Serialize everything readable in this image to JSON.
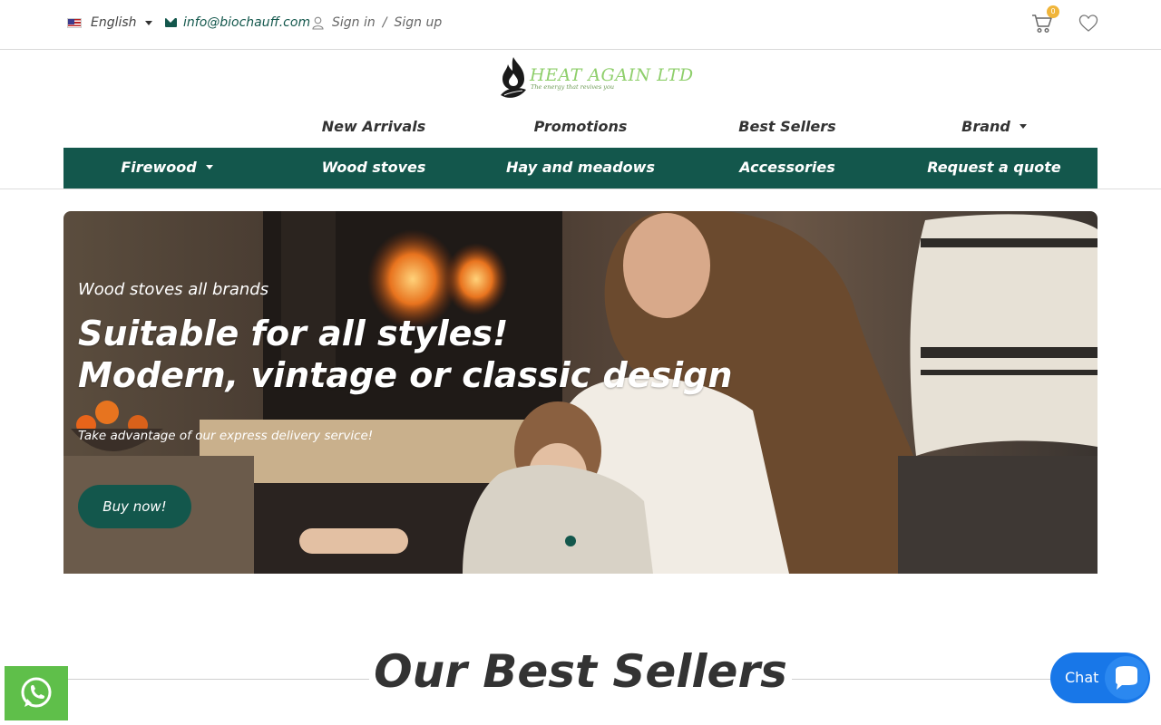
{
  "topbar": {
    "language": "English",
    "email": "info@biochauff.com",
    "sign_in": "Sign in",
    "separator": "/",
    "sign_up": "Sign up",
    "cart_count": "0",
    "icons": [
      "us-flag-icon",
      "envelope-icon",
      "user-icon",
      "cart-icon",
      "heart-icon"
    ]
  },
  "logo": {
    "name": "HEAT AGAIN LTD",
    "tagline": "The energy that revives you"
  },
  "nav_primary": [
    {
      "label": "New Arrivals"
    },
    {
      "label": "Promotions"
    },
    {
      "label": "Best Sellers"
    },
    {
      "label": "Brand"
    }
  ],
  "nav_secondary": [
    {
      "label": "Firewood"
    },
    {
      "label": "Wood stoves"
    },
    {
      "label": "Hay and meadows"
    },
    {
      "label": "Accessories"
    },
    {
      "label": "Request a quote"
    }
  ],
  "hero": {
    "kicker": "Wood stoves all brands",
    "headline_1": "Suitable for all styles!",
    "headline_2": "Modern, vintage or classic design",
    "subtext": "Take advantage of our express delivery service!",
    "cta": "Buy now!"
  },
  "section": {
    "title": "Our Best Sellers"
  },
  "chat": {
    "label": "Chat"
  },
  "colors": {
    "brand_green": "#13574c",
    "logo_green": "#8fcf6c",
    "whatsapp_green": "#5fbf4a",
    "chat_blue": "#1877e8",
    "badge_orange": "#f0b53a"
  }
}
